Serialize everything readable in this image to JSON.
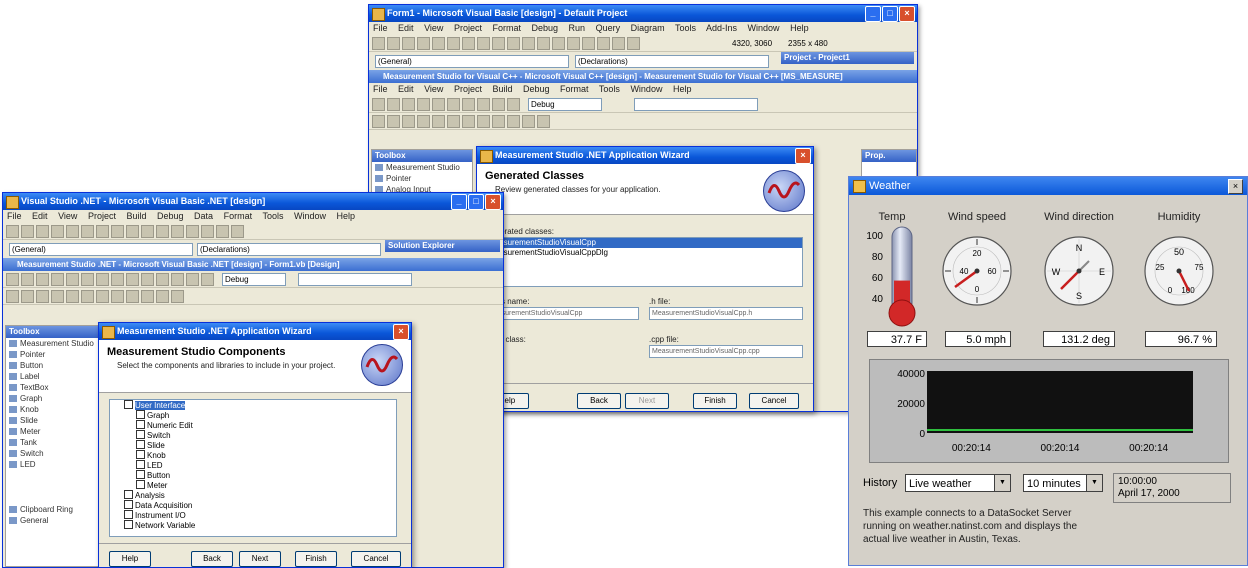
{
  "back_window": {
    "title": "Form1 - Microsoft Visual Basic [design] - Default Project",
    "menu": [
      "File",
      "Edit",
      "View",
      "Project",
      "Format",
      "Debug",
      "Run",
      "Query",
      "Diagram",
      "Tools",
      "Add-Ins",
      "Window",
      "Help"
    ],
    "combo1": "(General)",
    "combo2": "(Declarations)",
    "coords1": "4320, 3060",
    "coords2": "2355 x 480",
    "project_panel": "Project - Project1",
    "inner_title": "Measurement Studio for Visual C++ - Microsoft Visual C++ [design] - Measurement Studio for Visual C++ [MS_MEASURE]",
    "inner_menu": [
      "File",
      "Edit",
      "View",
      "Project",
      "Build",
      "Debug",
      "Format",
      "Tools",
      "Window",
      "Help"
    ],
    "combo3": "Debug",
    "toolbox_title": "Toolbox",
    "toolbox_items": [
      "Measurement Studio",
      "Pointer",
      "Analog Input"
    ],
    "properties_title": "Prop.",
    "wizard": {
      "title": "Measurement Studio .NET Application Wizard",
      "heading": "Generated Classes",
      "sub": "Review generated classes for your application.",
      "list_label": "Generated classes:",
      "list_items": [
        "MeasurementStudioVisualCpp",
        "MeasurementStudioVisualCppDlg"
      ],
      "field1_label": "Class name:",
      "field1_value": "MeasurementStudioVisualCpp",
      "field2_label": ".h file:",
      "field2_value": "MeasurementStudioVisualCpp.h",
      "field3_label": "Base class:",
      "field4_label": ".cpp file:",
      "field4_value": "MeasurementStudioVisualCpp.cpp",
      "buttons": [
        "Help",
        "Back",
        "Next",
        "Finish",
        "Cancel"
      ]
    }
  },
  "left_window": {
    "title": "Visual Studio .NET - Microsoft Visual Basic .NET [design]",
    "menu": [
      "File",
      "Edit",
      "View",
      "Project",
      "Build",
      "Debug",
      "Data",
      "Format",
      "Tools",
      "Window",
      "Help"
    ],
    "combo1": "(General)",
    "combo2": "(Declarations)",
    "combo3": "Debug",
    "panel_title": "Solution Explorer",
    "inner_title": "Measurement Studio .NET - Microsoft Visual Basic .NET [design] - Form1.vb [Design]",
    "toolbox_title": "Toolbox",
    "toolbox_items": [
      "Measurement Studio",
      "Pointer",
      "Button",
      "Label",
      "TextBox",
      "Graph",
      "Knob",
      "Slide",
      "Meter",
      "Tank",
      "Switch",
      "LED"
    ],
    "toolbox_footer": [
      "Clipboard Ring",
      "General"
    ],
    "wizard": {
      "title": "Measurement Studio .NET Application Wizard",
      "heading": "Measurement Studio Components",
      "sub": "Select the components and libraries to include in your project.",
      "tree": [
        "User Interface",
        "Graph",
        "Numeric Edit",
        "Switch",
        "Slide",
        "Knob",
        "LED",
        "Button",
        "Meter",
        "Analysis",
        "Data Acquisition",
        "Instrument I/O",
        "Network Variable"
      ],
      "buttons": [
        "Help",
        "Back",
        "Next",
        "Finish",
        "Cancel"
      ]
    }
  },
  "weather": {
    "title": "Weather",
    "labels": [
      "Temp",
      "Wind speed",
      "Wind direction",
      "Humidity"
    ],
    "temp_scale": [
      "100",
      "80",
      "60",
      "40"
    ],
    "readouts": [
      "37.7 F",
      "5.0 mph",
      "131.2 deg",
      "96.7 %"
    ],
    "temp_fraction": 0.377,
    "wind_speed_dial": [
      "20",
      "40",
      "0",
      "60"
    ],
    "compass": [
      "N",
      "W",
      "E",
      "S"
    ],
    "humidity_dial": [
      "50",
      "25",
      "75",
      "0",
      "100"
    ],
    "chart_y": [
      "40000",
      "20000",
      "0"
    ],
    "chart_x": [
      "00:20:14",
      "00:20:14",
      "00:20:14"
    ],
    "history_label": "History",
    "history_select": "Live weather",
    "range_select": "10 minutes",
    "time_display": "10:00:00",
    "date_display": "April 17, 2000",
    "description": "This example connects to a DataSocket Server running on weather.natinst.com and displays the actual live weather in Austin, Texas."
  },
  "colors": {
    "titlebar": "#0a56d8",
    "chart_bg": "#111111",
    "trace": "#2fbf3f",
    "mercury": "#d22828"
  }
}
